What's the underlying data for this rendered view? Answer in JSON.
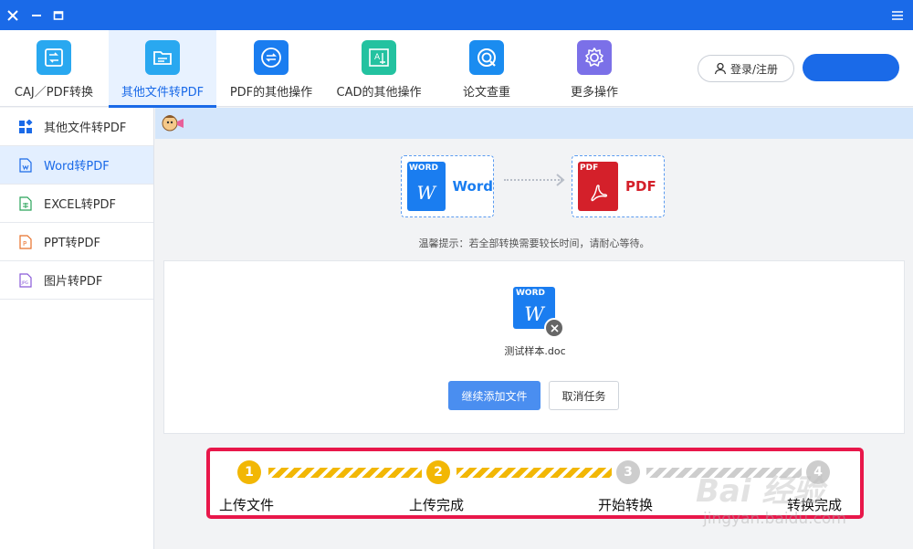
{
  "toolbar": {
    "items": [
      {
        "label": "CAJ／PDF转换",
        "color": "#29a8f0"
      },
      {
        "label": "其他文件转PDF",
        "color": "#29a8f0"
      },
      {
        "label": "PDF的其他操作",
        "color": "#1a7df0"
      },
      {
        "label": "CAD的其他操作",
        "color": "#23c2a0"
      },
      {
        "label": "论文查重",
        "color": "#1a8cf0"
      },
      {
        "label": "更多操作",
        "color": "#7b70e8"
      }
    ],
    "active_index": 1,
    "login_label": "登录/注册"
  },
  "sidebar": {
    "items": [
      {
        "label": "其他文件转PDF",
        "icon": "grid-icon"
      },
      {
        "label": "Word转PDF",
        "icon": "word-file-icon"
      },
      {
        "label": "EXCEL转PDF",
        "icon": "excel-file-icon"
      },
      {
        "label": "PPT转PDF",
        "icon": "ppt-file-icon"
      },
      {
        "label": "图片转PDF",
        "icon": "image-file-icon"
      }
    ],
    "active_index": 1
  },
  "conversion": {
    "from_tag": "WORD",
    "from_letter": "W",
    "from_label": "Word",
    "to_tag": "PDF",
    "to_label": "PDF"
  },
  "tip": "温馨提示：若全部转换需要较长时间，请耐心等待。",
  "file": {
    "tag": "WORD",
    "letter": "W",
    "name": "测试样本.doc"
  },
  "buttons": {
    "add_more": "继续添加文件",
    "cancel_task": "取消任务"
  },
  "steps": [
    {
      "num": "1",
      "label": "上传文件",
      "done": true
    },
    {
      "num": "2",
      "label": "上传完成",
      "done": true
    },
    {
      "num": "3",
      "label": "开始转换",
      "done": false
    },
    {
      "num": "4",
      "label": "转换完成",
      "done": false
    }
  ],
  "watermark": {
    "text": "Bai 经验",
    "sub": "jingyan.baidu.com"
  },
  "colors": {
    "accent": "#1a6ae8",
    "step_done": "#f2b705",
    "step_pending": "#cdcdcd",
    "highlight_border": "#e8174a"
  }
}
